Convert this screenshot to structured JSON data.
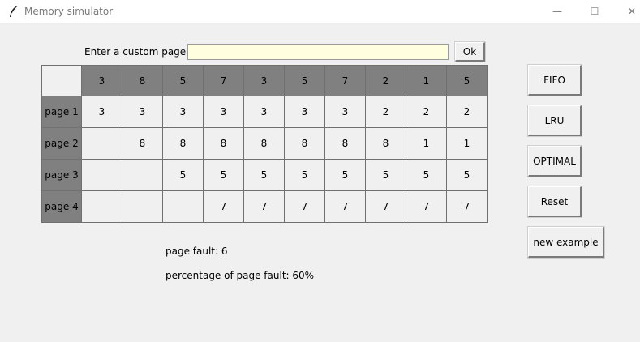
{
  "window": {
    "title": "Memory simulator",
    "min_glyph": "—",
    "max_glyph": "☐",
    "close_glyph": "✕"
  },
  "input": {
    "label": "Enter a custom page list",
    "value": "",
    "ok_label": "Ok"
  },
  "table": {
    "references": [
      "3",
      "8",
      "5",
      "7",
      "3",
      "5",
      "7",
      "2",
      "1",
      "5"
    ],
    "rows": [
      {
        "label": "page 1",
        "cells": [
          "3",
          "3",
          "3",
          "3",
          "3",
          "3",
          "3",
          "2",
          "2",
          "2"
        ]
      },
      {
        "label": "page 2",
        "cells": [
          "",
          "8",
          "8",
          "8",
          "8",
          "8",
          "8",
          "8",
          "1",
          "1"
        ]
      },
      {
        "label": "page 3",
        "cells": [
          "",
          "",
          "5",
          "5",
          "5",
          "5",
          "5",
          "5",
          "5",
          "5"
        ]
      },
      {
        "label": "page 4",
        "cells": [
          "",
          "",
          "",
          "7",
          "7",
          "7",
          "7",
          "7",
          "7",
          "7"
        ]
      }
    ]
  },
  "buttons": {
    "fifo": "FIFO",
    "lru": "LRU",
    "optimal": "OPTIMAL",
    "reset": "Reset",
    "new_example": "new example"
  },
  "stats": {
    "page_fault": "page fault: 6",
    "percentage": "percentage of page fault: 60%"
  },
  "colors": {
    "header_fill": "#808080",
    "input_bg": "#ffffe0",
    "window_bg": "#f0f0f0"
  }
}
